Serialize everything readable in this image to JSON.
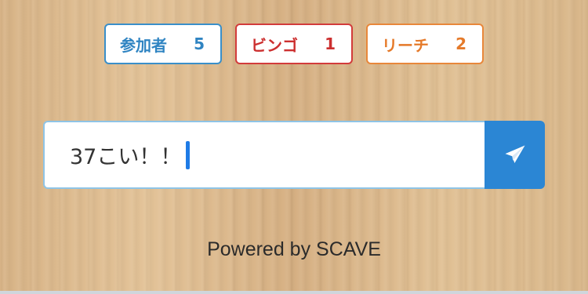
{
  "stats": {
    "participants": {
      "label": "参加者",
      "count": "5",
      "color": "#2f84c2"
    },
    "bingo": {
      "label": "ビンゴ",
      "count": "1",
      "color": "#cc2f2f"
    },
    "reach": {
      "label": "リーチ",
      "count": "2",
      "color": "#e57a2a"
    }
  },
  "chat": {
    "input_value": "37こい！！",
    "send_icon": "paper-plane-icon"
  },
  "footer": {
    "powered_by": "Powered by SCAVE"
  },
  "colors": {
    "accent": "#2b86d4",
    "caret": "#1e7be6"
  }
}
